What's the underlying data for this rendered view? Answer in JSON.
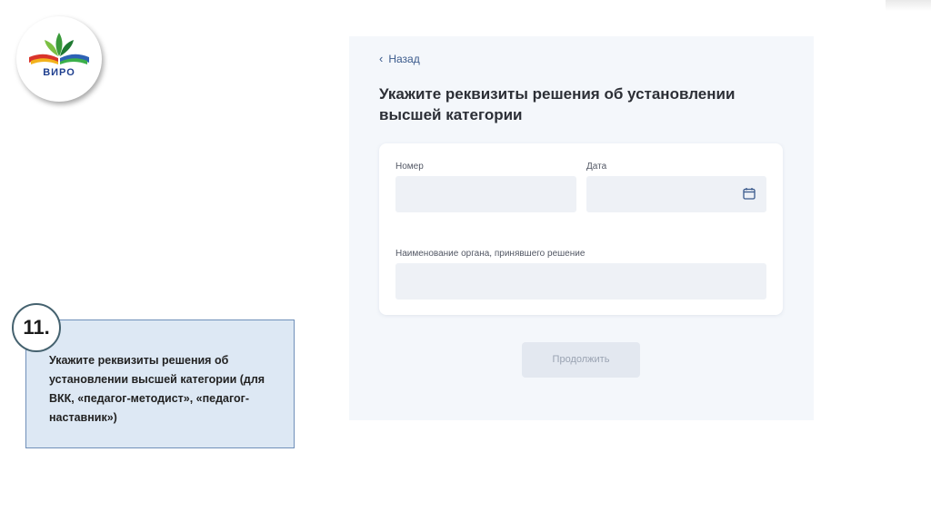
{
  "logo": {
    "text": "ВИРО"
  },
  "screen": {
    "back_label": "Назад",
    "heading": "Укажите реквизиты решения об установлении высшей категории",
    "fields": {
      "number_label": "Номер",
      "number_value": "",
      "date_label": "Дата",
      "date_value": "",
      "organ_label": "Наименование органа, принявшего решение",
      "organ_value": ""
    },
    "continue_label": "Продолжить"
  },
  "step": {
    "number": "11.",
    "text": "Укажите реквизиты решения об установлении высшей категории (для ВКК, «педагог-методист», «педагог-наставник»)"
  },
  "colors": {
    "panel_bg": "#f4f7fb",
    "field_bg": "#eef1f6",
    "step_box_bg": "#dde8f4",
    "accent": "#3a5a8c"
  }
}
